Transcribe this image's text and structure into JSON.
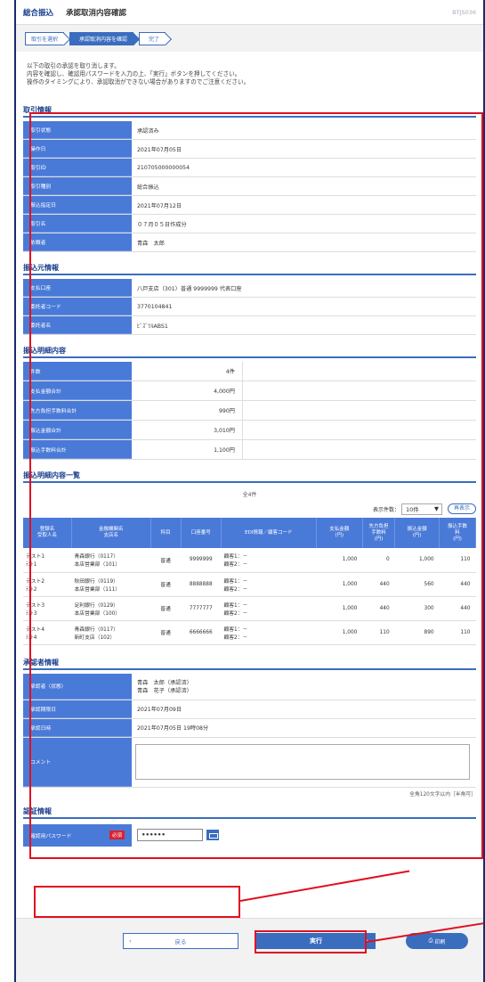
{
  "header": {
    "title": "総合振込",
    "subtitle": "承認取消内容確認",
    "code": "BTJS036"
  },
  "steps": [
    "取引を選択",
    "承認取消内容を確認",
    "完了"
  ],
  "intro": [
    "以下の取引の承認を取り消します。",
    "内容を確認し、確認用パスワードを入力の上、「実行」ボタンを押してください。",
    "操作のタイミングにより、承認取消ができない場合がありますのでご注意ください。"
  ],
  "trade": {
    "title": "取引情報",
    "rows": [
      {
        "k": "取引状態",
        "v": "承認済み"
      },
      {
        "k": "操作日",
        "v": "2021年07月05日"
      },
      {
        "k": "取引ID",
        "v": "210705000000054"
      },
      {
        "k": "取引種別",
        "v": "総合振込"
      },
      {
        "k": "振込指定日",
        "v": "2021年07月12日"
      },
      {
        "k": "取引名",
        "v": "０７月０５日作成分"
      },
      {
        "k": "依頼者",
        "v": "青森　太郎"
      }
    ]
  },
  "source": {
    "title": "振込元情報",
    "rows": [
      {
        "k": "支払口座",
        "v": "八戸支店（301）普通 9999999 代表口座"
      },
      {
        "k": "委託者コード",
        "v": "3770104841"
      },
      {
        "k": "委託者名",
        "v": "ﾋﾞｽﾞﾂﾙABS1"
      }
    ]
  },
  "detail": {
    "title": "振込明細内容",
    "rows": [
      {
        "k": "件数",
        "v": "4件"
      },
      {
        "k": "支払金額合計",
        "v": "4,000円"
      },
      {
        "k": "先方負担手数料合計",
        "v": "990円"
      },
      {
        "k": "振込金額合計",
        "v": "3,010円"
      },
      {
        "k": "振込手数料合計",
        "v": "1,100円"
      }
    ]
  },
  "list": {
    "title": "振込明細内容一覧",
    "count": "全4件",
    "per_page_label": "表示件数：",
    "per_page": "10件",
    "redisplay": "再表示",
    "headers": [
      "登録名\n受取人名",
      "金融機関名\n支店名",
      "科目",
      "口座番号",
      "EDI情報／顧客コード",
      "支払金額\n(円)",
      "先方負担\n手数料\n(円)",
      "振込金額\n(円)",
      "振込手数\n料\n(円)"
    ],
    "rows": [
      [
        "テスト1\nﾃｽﾄ1",
        "青森銀行（0117）\n本店営業部（101）",
        "普通",
        "9999999",
        "顧客1：－\n顧客2：－",
        "1,000",
        "0",
        "1,000",
        "110"
      ],
      [
        "テスト2\nﾃｽﾄ2",
        "秋田銀行（0119）\n本店営業部（111）",
        "普通",
        "8888888",
        "顧客1：－\n顧客2：－",
        "1,000",
        "440",
        "560",
        "440"
      ],
      [
        "テスト3\nﾃｽﾄ3",
        "足利銀行（0129）\n本店営業部（100）",
        "普通",
        "7777777",
        "顧客1：－\n顧客2：－",
        "1,000",
        "440",
        "300",
        "440"
      ],
      [
        "テスト4\nﾃｽﾄ4",
        "青森銀行（0117）\n新町支店（102）",
        "普通",
        "6666666",
        "顧客1：－\n顧客2：－",
        "1,000",
        "110",
        "890",
        "110"
      ]
    ]
  },
  "approver": {
    "title": "承認者情報",
    "rows": [
      {
        "k": "承認者（状態）",
        "v": "青森　太郎（承認済）\n青森　花子（承認済）"
      },
      {
        "k": "承認期限日",
        "v": "2021年07月09日"
      },
      {
        "k": "承認日時",
        "v": "2021年07月05日 19時08分"
      }
    ],
    "comment_label": "コメント",
    "comment_note": "全角120文字以内［半角可］"
  },
  "auth": {
    "title": "認証情報",
    "label": "確認用パスワード",
    "required": "必須",
    "value": "••••••"
  },
  "buttons": {
    "back": "戻る",
    "exec": "実行",
    "print": "印刷"
  },
  "colors": {
    "accent": "#3b6dbf",
    "highlight": "#e01020"
  }
}
